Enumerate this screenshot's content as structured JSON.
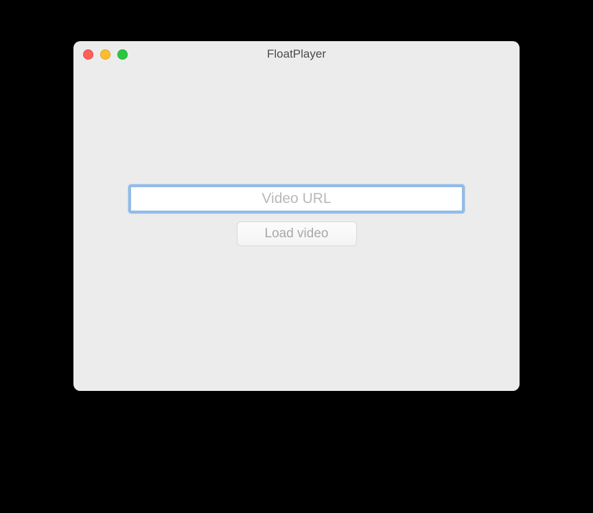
{
  "window": {
    "title": "FloatPlayer"
  },
  "form": {
    "url_placeholder": "Video URL",
    "url_value": "",
    "load_button_label": "Load video"
  }
}
